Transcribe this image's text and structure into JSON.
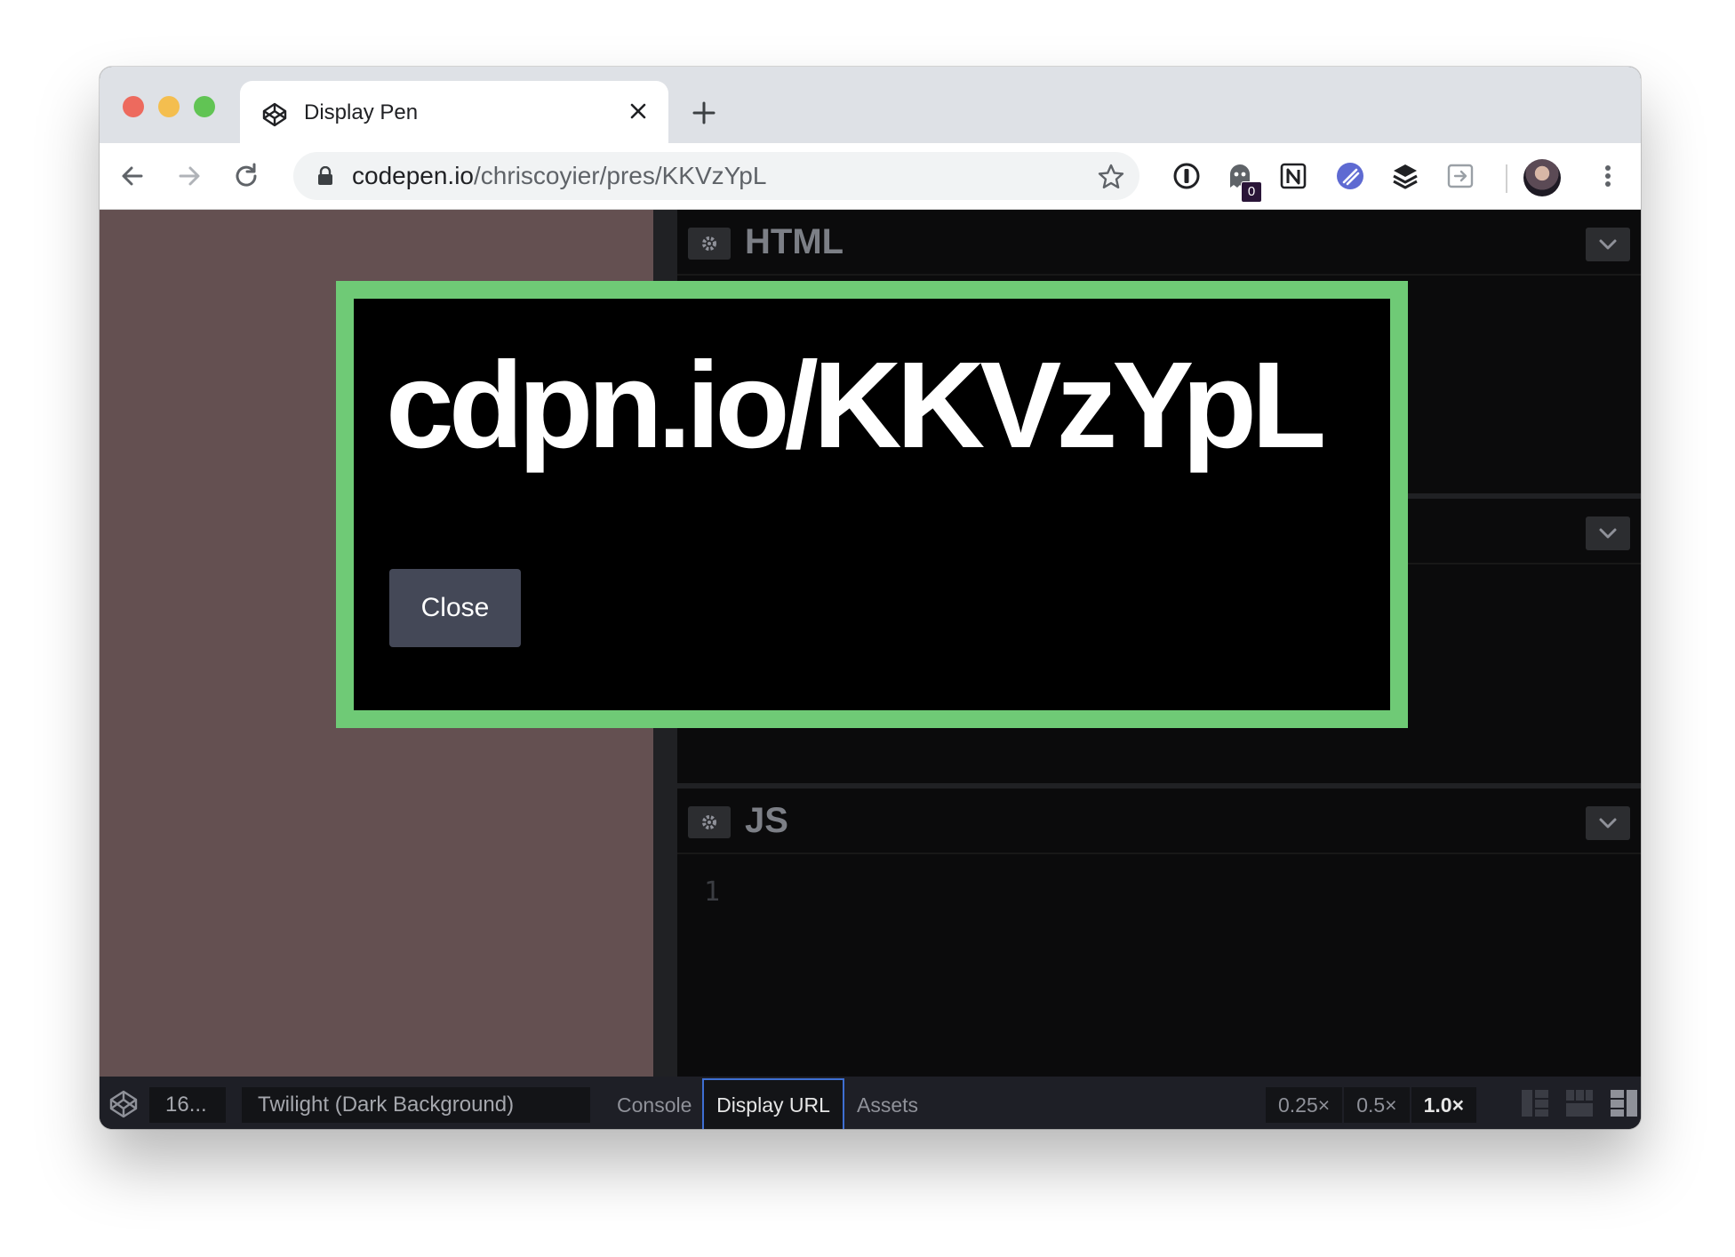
{
  "browser": {
    "tab_title": "Display Pen",
    "url_host": "codepen.io",
    "url_path": "/chriscoyier/pres/KKVzYpL",
    "extension_badge": "0"
  },
  "editors": {
    "html_title": "HTML",
    "js_title": "JS",
    "js_line_number": "1"
  },
  "footer": {
    "font_size": "16...",
    "theme": "Twilight (Dark Background)",
    "console": "Console",
    "display_url": "Display URL",
    "assets": "Assets",
    "zoom": [
      "0.25×",
      "0.5×",
      "1.0×"
    ]
  },
  "modal": {
    "url": "cdpn.io/KKVzYpL",
    "close_label": "Close"
  },
  "colors": {
    "modal_border": "#6fca76",
    "preview_bg": "#645051",
    "active_tab_border": "#3e6fd2"
  },
  "icons": [
    "codepen-icon",
    "close-icon",
    "plus-icon",
    "back-arrow-icon",
    "forward-arrow-icon",
    "reload-icon",
    "lock-icon",
    "star-icon",
    "1password-icon",
    "ghostery-icon",
    "notion-icon",
    "linear-icon",
    "buffer-icon",
    "exit-icon",
    "kebab-menu-icon",
    "gear-icon",
    "chevron-down-icon"
  ]
}
